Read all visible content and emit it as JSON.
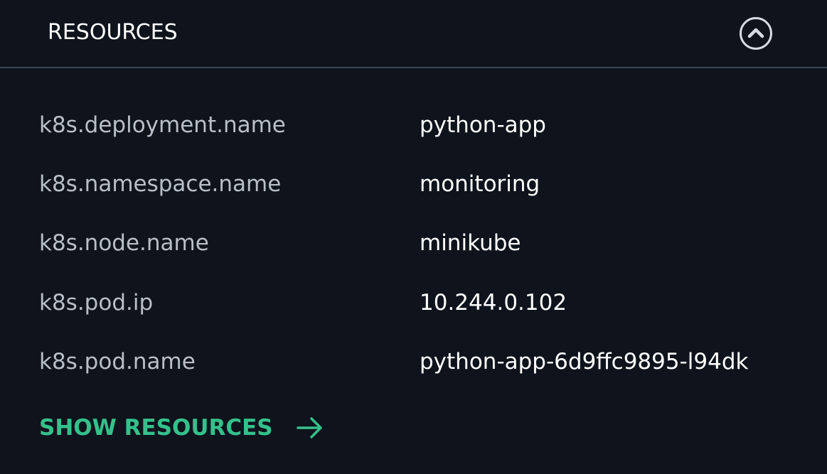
{
  "header": {
    "title": "RESOURCES",
    "collapse_icon": "chevron-up-circle-icon"
  },
  "resources": [
    {
      "key": "k8s.deployment.name",
      "value": "python-app"
    },
    {
      "key": "k8s.namespace.name",
      "value": "monitoring"
    },
    {
      "key": "k8s.node.name",
      "value": "minikube"
    },
    {
      "key": "k8s.pod.ip",
      "value": "10.244.0.102"
    },
    {
      "key": "k8s.pod.name",
      "value": "python-app-6d9ffc9895-l94dk"
    }
  ],
  "footer": {
    "show_label": "SHOW RESOURCES",
    "arrow_icon": "arrow-right-icon"
  },
  "colors": {
    "background": "#0e131c",
    "accent": "#34c18b",
    "divider": "#3a4556"
  }
}
